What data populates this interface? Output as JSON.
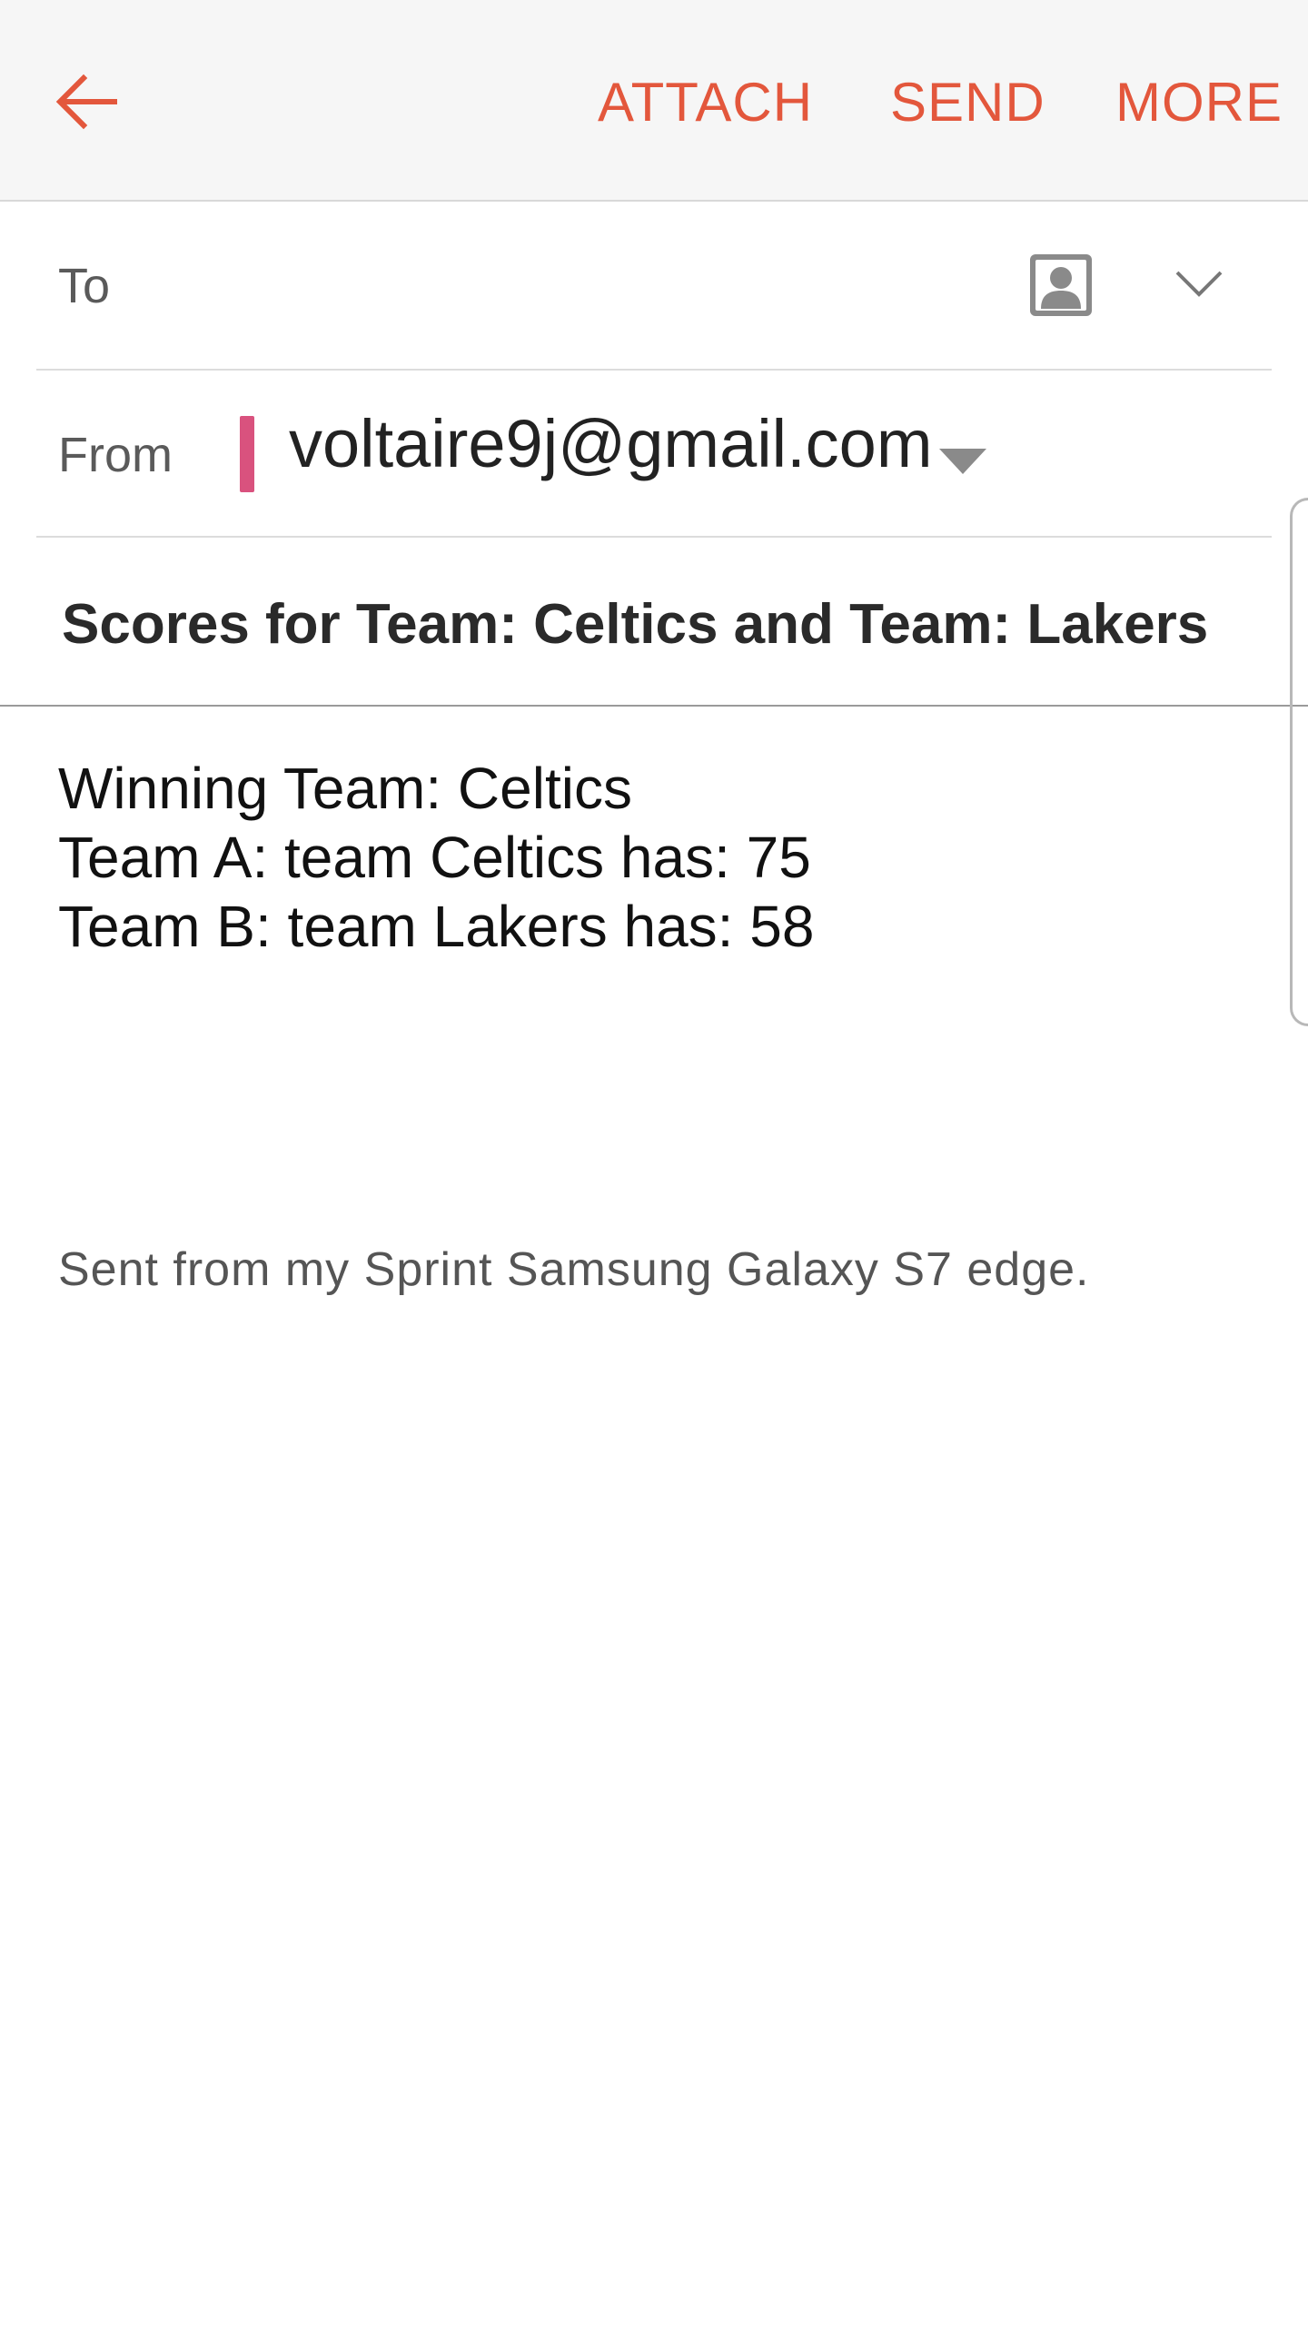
{
  "toolbar": {
    "back_icon": "arrow-left-icon",
    "attach_label": "ATTACH",
    "send_label": "SEND",
    "more_label": "MORE",
    "accent_color": "#e3573c"
  },
  "compose": {
    "to": {
      "label": "To",
      "value": "",
      "contact_icon": "contact-card-icon",
      "expand_icon": "chevron-down-icon"
    },
    "from": {
      "label": "From",
      "email": "voltaire9j@gmail.com",
      "account_color": "#d9527e",
      "dropdown_icon": "triangle-down-icon"
    },
    "subject": "Scores for Team: Celtics and Team: Lakers",
    "body_lines": [
      "Winning Team: Celtics",
      "Team A: team Celtics has: 75",
      "Team B: team Lakers has: 58"
    ],
    "signature": "Sent from my Sprint Samsung Galaxy S7 edge."
  }
}
